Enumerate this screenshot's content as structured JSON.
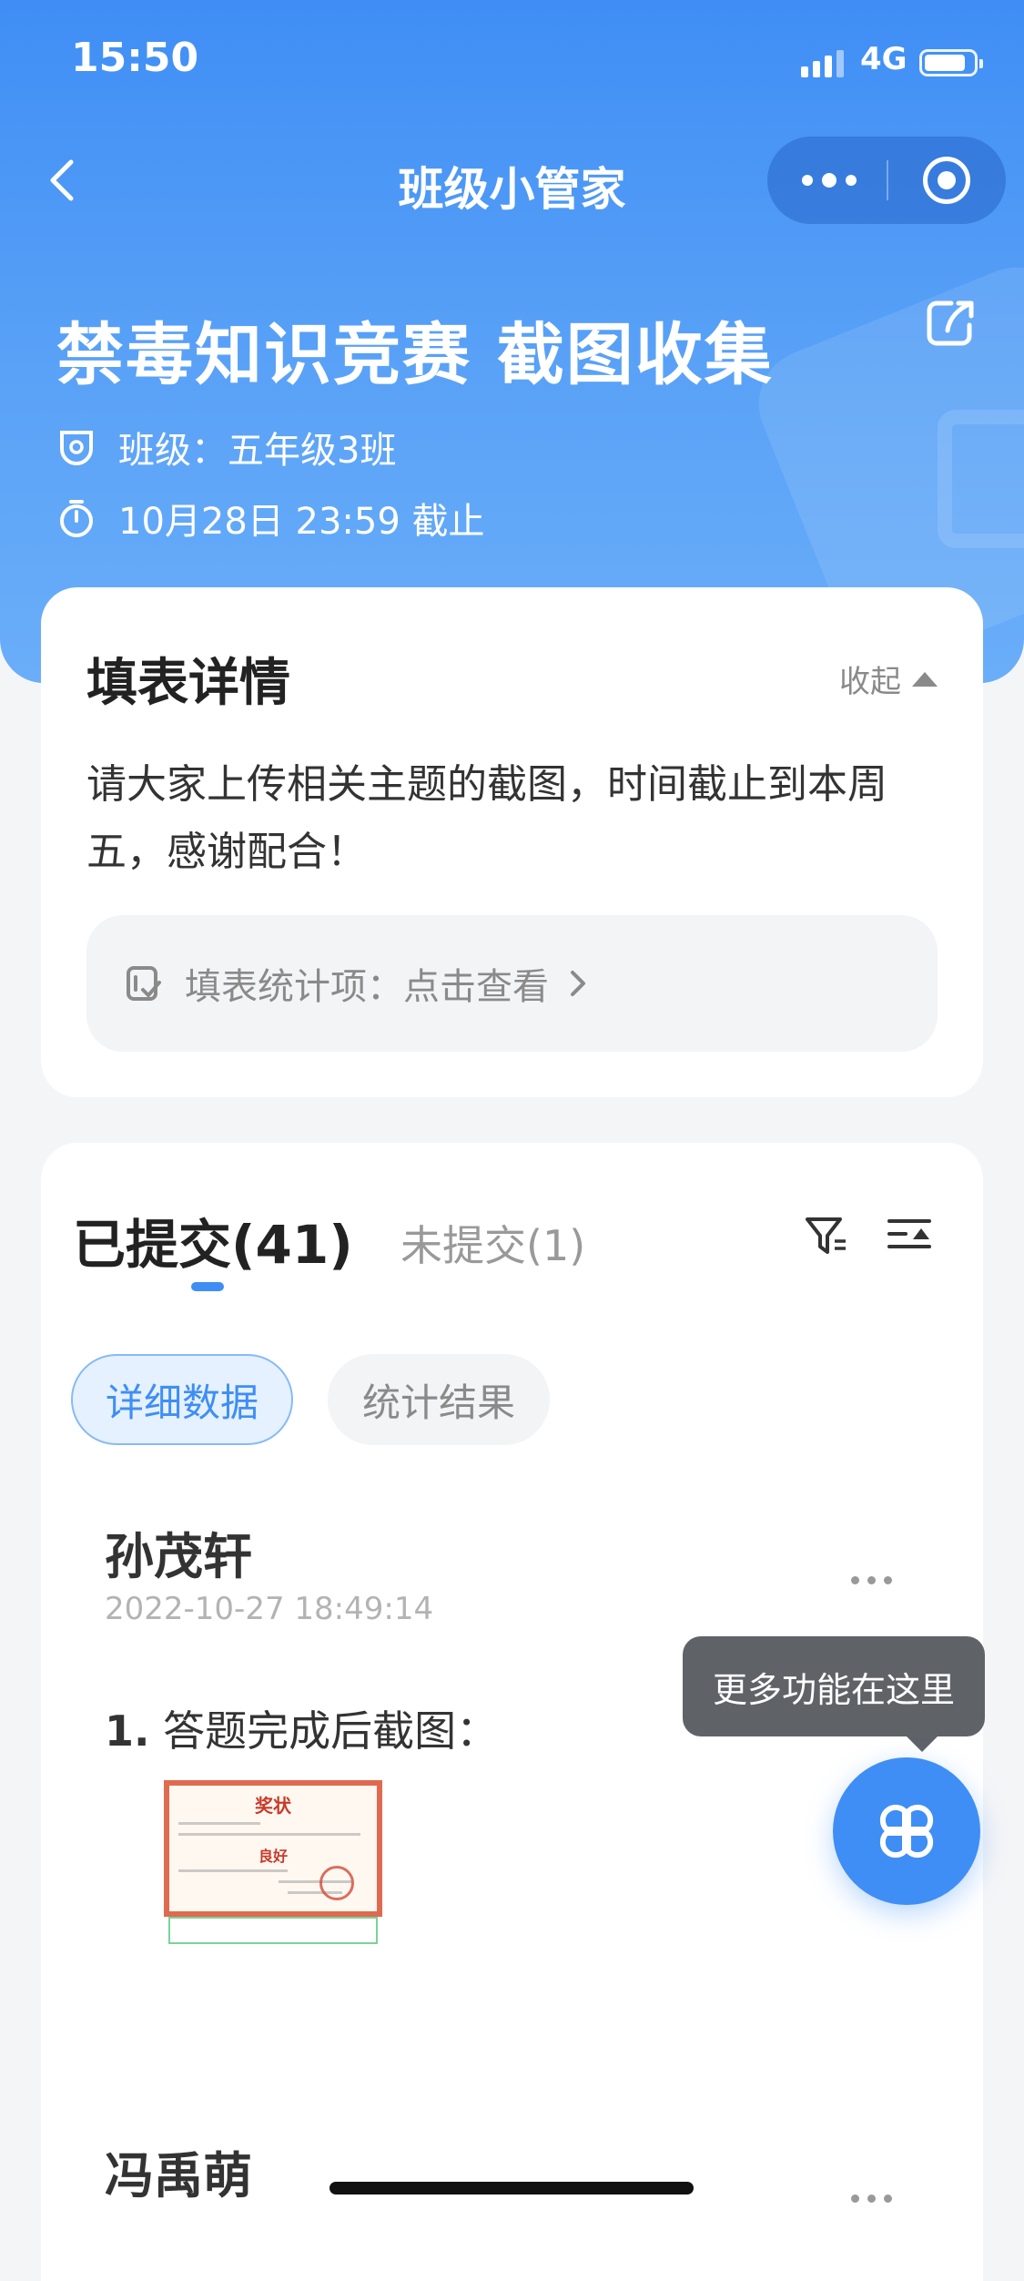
{
  "status_bar": {
    "time": "15:50",
    "network": "4G"
  },
  "nav": {
    "title": "班级小管家"
  },
  "form": {
    "title": "禁毒知识竞赛 截图收集",
    "class_text": "班级：五年级3班",
    "deadline_text": "10月28日 23:59 截止"
  },
  "detail": {
    "title": "填表详情",
    "collapse_label": "收起",
    "description": "请大家上传相关主题的截图，时间截止到本周五，感谢配合！",
    "stats_link": "填表统计项：点击查看"
  },
  "tabs": {
    "submitted": "已提交(41)",
    "unsubmitted": "未提交(1)"
  },
  "chips": {
    "detail_data": "详细数据",
    "stat_results": "统计结果"
  },
  "entries": [
    {
      "name": "孙茂轩",
      "time": "2022-10-27 18:49:14",
      "question_number": "1.",
      "question": "答题完成后截图：",
      "attachment": {
        "title": "奖状",
        "grade": "良好"
      }
    },
    {
      "name": "冯禹萌"
    }
  ],
  "tooltip": "更多功能在这里",
  "colors": {
    "primary": "#3f8ef5",
    "header_gradient_top": "#3f8ef5",
    "tooltip_bg": "#5f6368"
  },
  "icons": [
    "back-icon",
    "more-dots-icon",
    "target-icon",
    "share-icon",
    "badge-icon",
    "stopwatch-icon",
    "form-icon",
    "chevron-right-icon",
    "filter-icon",
    "sort-icon",
    "clover-icon"
  ]
}
